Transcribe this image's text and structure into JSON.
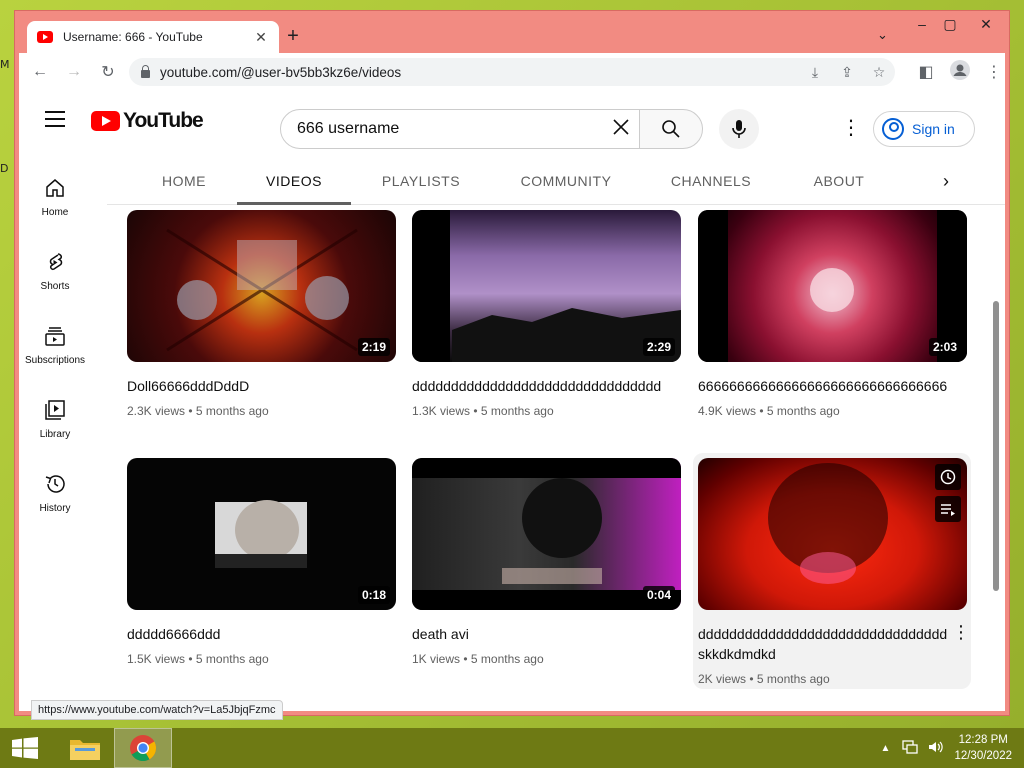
{
  "browser": {
    "tab_title": "Username: 666 - YouTube",
    "url": "youtube.com/@user-bv5bb3kz6e/videos",
    "status_url": "https://www.youtube.com/watch?v=La5JbjqFzmc"
  },
  "youtube": {
    "logo_text": "YouTube",
    "search_value": "666 username",
    "sign_in_label": "Sign in"
  },
  "sidebar": {
    "items": [
      {
        "label": "Home",
        "icon": "home-icon"
      },
      {
        "label": "Shorts",
        "icon": "shorts-icon"
      },
      {
        "label": "Subscriptions",
        "icon": "subscriptions-icon"
      },
      {
        "label": "Library",
        "icon": "library-icon"
      },
      {
        "label": "History",
        "icon": "history-icon"
      }
    ]
  },
  "channel_tabs": [
    {
      "label": "HOME"
    },
    {
      "label": "VIDEOS",
      "active": true
    },
    {
      "label": "PLAYLISTS"
    },
    {
      "label": "COMMUNITY"
    },
    {
      "label": "CHANNELS"
    },
    {
      "label": "ABOUT"
    }
  ],
  "videos": [
    {
      "title": "Doll66666dddDddD",
      "duration": "2:19",
      "views": "2.3K views",
      "age": "5 months ago"
    },
    {
      "title": "dddddddddddddddddddddddddddddddd",
      "duration": "2:29",
      "views": "1.3K views",
      "age": "5 months ago"
    },
    {
      "title": "66666666666666666666666666666666",
      "duration": "2:03",
      "views": "4.9K views",
      "age": "5 months ago"
    },
    {
      "title": "ddddd6666ddd",
      "duration": "0:18",
      "views": "1.5K views",
      "age": "5 months ago"
    },
    {
      "title": "death avi",
      "duration": "0:04",
      "views": "1K views",
      "age": "5 months ago"
    },
    {
      "title": "dddddddddddddddddddddddddddddddd skkdkdmdkd",
      "duration": "",
      "views": "2K views",
      "age": "5 months ago"
    }
  ],
  "taskbar": {
    "time": "12:28 PM",
    "date": "12/30/2022"
  },
  "colors": {
    "window_frame": "#f28b82",
    "yt_red": "#ff0000",
    "link_blue": "#065fd4",
    "taskbar": "#6e7a14"
  }
}
